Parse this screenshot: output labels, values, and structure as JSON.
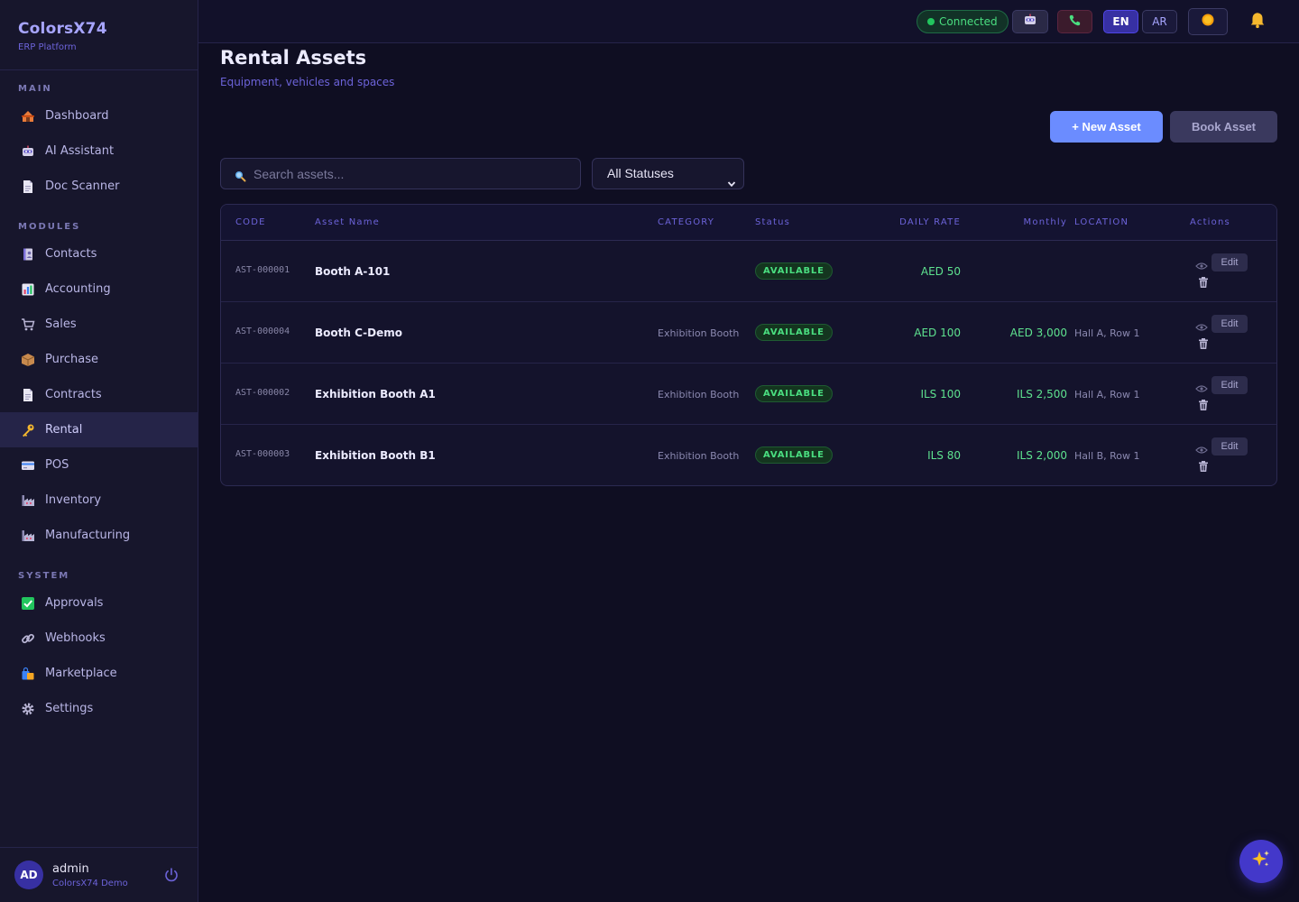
{
  "brand": {
    "title": "ColorsX74",
    "subtitle": "ERP Platform"
  },
  "sidebar": {
    "sections": [
      {
        "label": "MAIN",
        "items": [
          {
            "label": "Dashboard",
            "icon": "house-icon"
          },
          {
            "label": "AI Assistant",
            "icon": "robot-icon"
          },
          {
            "label": "Doc Scanner",
            "icon": "document-icon"
          }
        ]
      },
      {
        "label": "MODULES",
        "items": [
          {
            "label": "Contacts",
            "icon": "address-book-icon"
          },
          {
            "label": "Accounting",
            "icon": "bar-chart-icon"
          },
          {
            "label": "Sales",
            "icon": "cart-icon"
          },
          {
            "label": "Purchase",
            "icon": "package-icon"
          },
          {
            "label": "Contracts",
            "icon": "document-icon"
          },
          {
            "label": "Rental",
            "icon": "key-icon",
            "active": true
          },
          {
            "label": "POS",
            "icon": "credit-card-icon"
          },
          {
            "label": "Inventory",
            "icon": "factory-icon"
          },
          {
            "label": "Manufacturing",
            "icon": "factory-icon"
          }
        ]
      },
      {
        "label": "SYSTEM",
        "items": [
          {
            "label": "Approvals",
            "icon": "check-box-icon"
          },
          {
            "label": "Webhooks",
            "icon": "link-icon"
          },
          {
            "label": "Marketplace",
            "icon": "shopping-bags-icon"
          },
          {
            "label": "Settings",
            "icon": "gear-icon"
          }
        ]
      }
    ]
  },
  "user": {
    "initials": "AD",
    "name": "admin",
    "org": "ColorsX74 Demo"
  },
  "topbar": {
    "status": "Connected",
    "lang_en": "EN",
    "lang_ar": "AR"
  },
  "page": {
    "title": "Rental Assets",
    "subtitle": "Equipment, vehicles and spaces"
  },
  "actions": {
    "new_asset": "+ New Asset",
    "book_asset": "Book Asset"
  },
  "search": {
    "placeholder": "Search assets..."
  },
  "filter": {
    "selected": "All Statuses"
  },
  "table": {
    "headers": {
      "code": "CODE",
      "name": "Asset Name",
      "category": "CATEGORY",
      "status": "Status",
      "daily": "DAILY RATE",
      "monthly": "Monthly",
      "location": "LOCATION",
      "actions": "Actions"
    },
    "edit_label": "Edit",
    "rows": [
      {
        "code": "AST-000001",
        "name": "Booth A-101",
        "category": "",
        "status": "AVAILABLE",
        "daily": "AED 50",
        "monthly": "",
        "location": ""
      },
      {
        "code": "AST-000004",
        "name": "Booth C-Demo",
        "category": "Exhibition Booth",
        "status": "AVAILABLE",
        "daily": "AED 100",
        "monthly": "AED 3,000",
        "location": "Hall A, Row 1"
      },
      {
        "code": "AST-000002",
        "name": "Exhibition Booth A1",
        "category": "Exhibition Booth",
        "status": "AVAILABLE",
        "daily": "ILS 100",
        "monthly": "ILS 2,500",
        "location": "Hall A, Row 1"
      },
      {
        "code": "AST-000003",
        "name": "Exhibition Booth B1",
        "category": "Exhibition Booth",
        "status": "AVAILABLE",
        "daily": "ILS 80",
        "monthly": "ILS 2,000",
        "location": "Hall B, Row 1"
      }
    ]
  },
  "colors": {
    "accent": "#6b8cff",
    "success": "#4ade80",
    "brand": "#a7a5ff"
  }
}
